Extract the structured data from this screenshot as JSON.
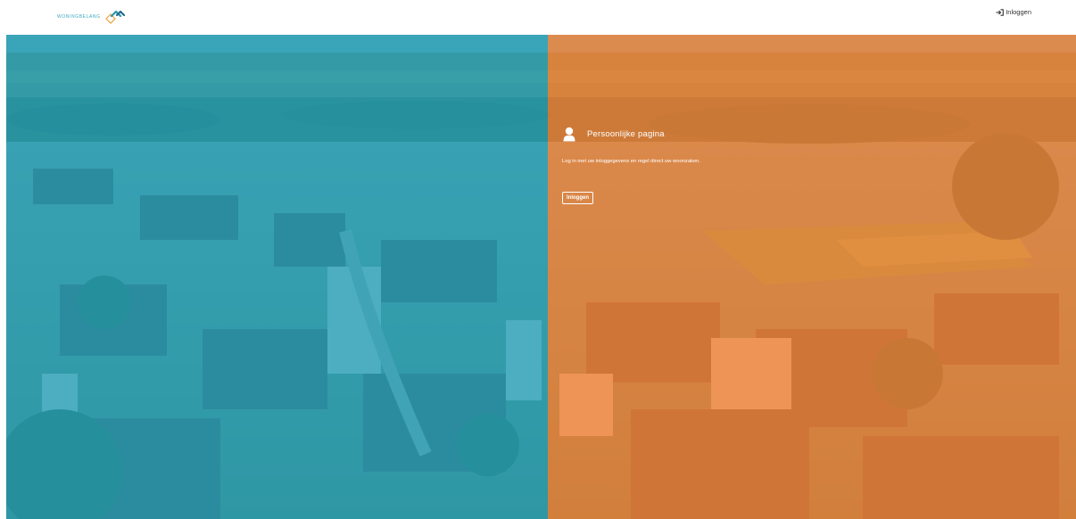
{
  "header": {
    "logo_text": "WONINGBELANG",
    "login_link_label": "Inloggen"
  },
  "hero": {
    "left_overlay_color": "#24a4be",
    "right_overlay_color": "#f1843a"
  },
  "login_card": {
    "title": "Persoonlijke pagina",
    "description": "Log in met uw inloggegevens en regel direct uw woonzaken.",
    "button_label": "Inloggen"
  },
  "icons": {
    "logo": "house-diamond-icon",
    "login": "sign-in-icon",
    "user": "user-icon"
  }
}
